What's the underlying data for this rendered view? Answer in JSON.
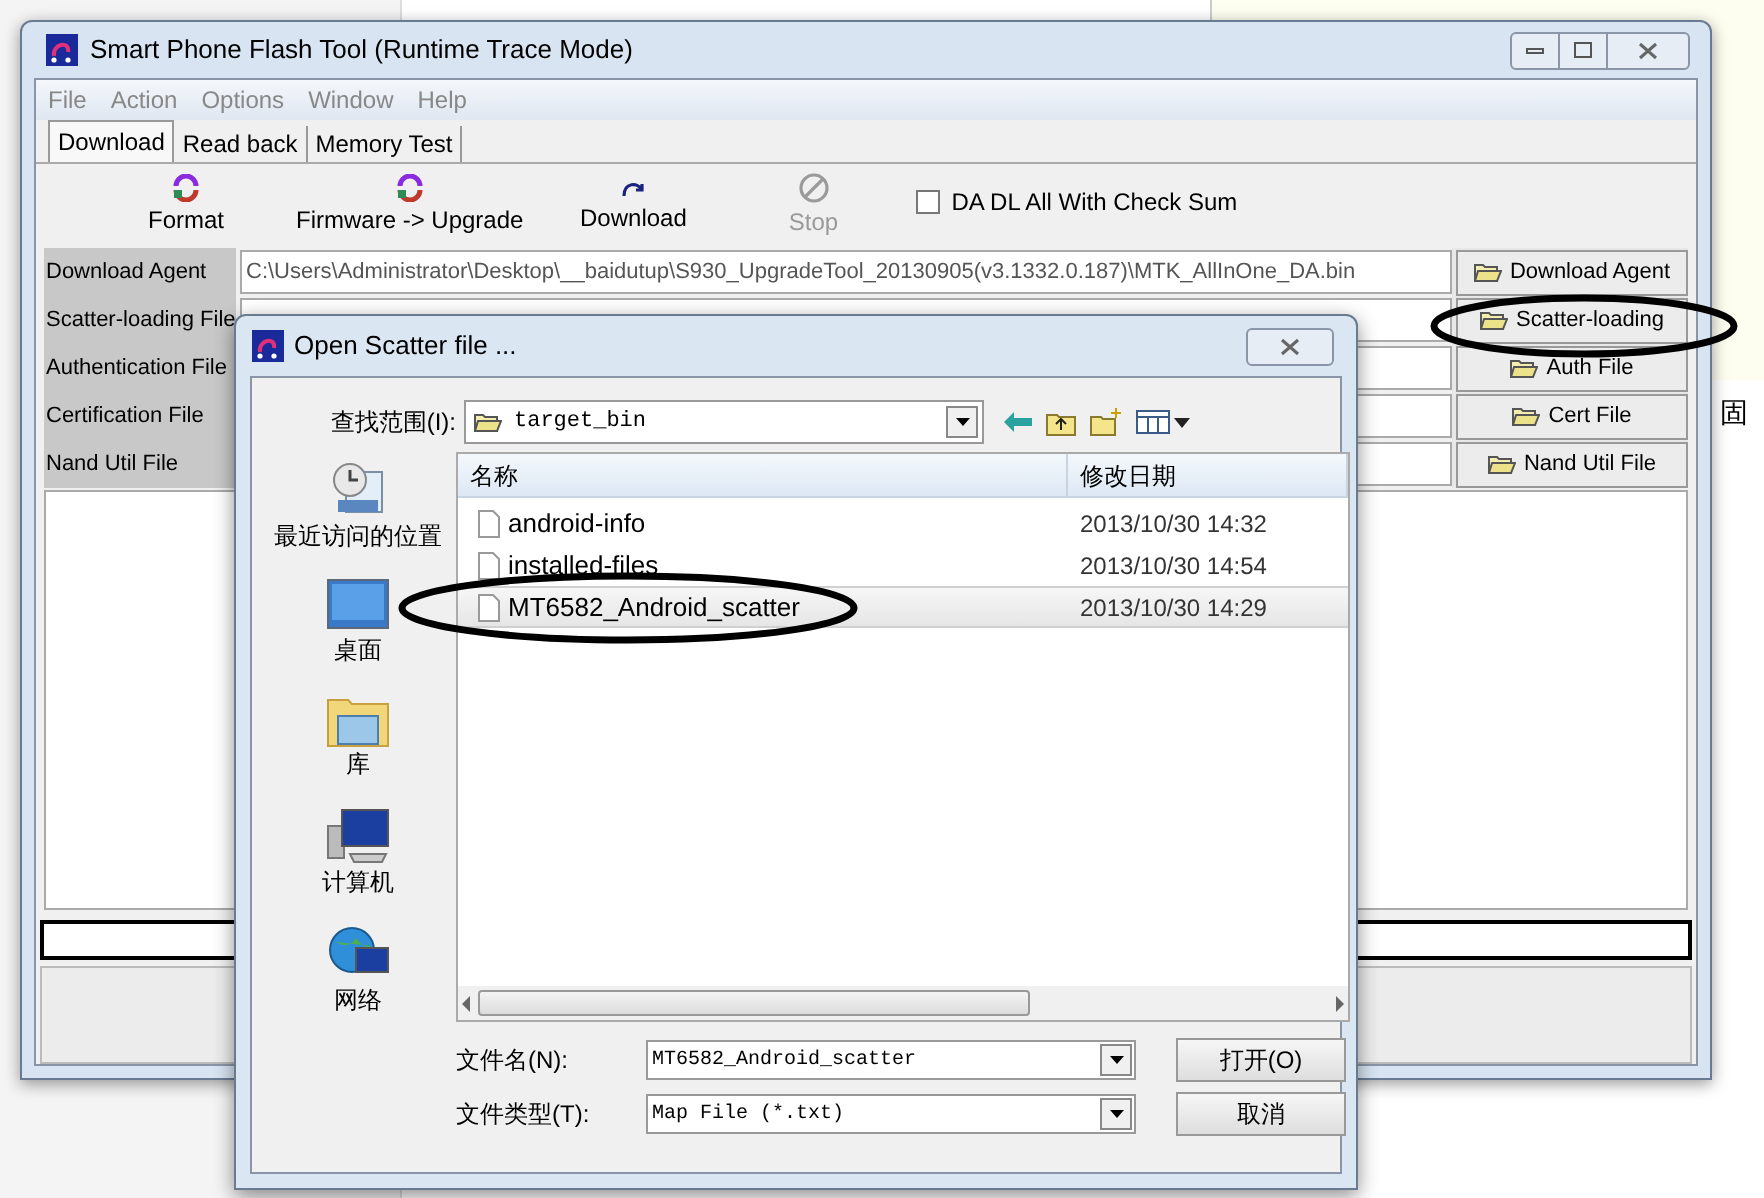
{
  "background_page": {
    "texts": [
      "固"
    ]
  },
  "main_window": {
    "title": "Smart Phone Flash Tool (Runtime Trace Mode)",
    "menu": [
      "File",
      "Action",
      "Options",
      "Window",
      "Help"
    ],
    "tabs": [
      {
        "label": "Download",
        "selected": true
      },
      {
        "label": "Read back",
        "selected": false
      },
      {
        "label": "Memory Test",
        "selected": false
      }
    ],
    "toolbar": [
      {
        "label": "Format",
        "kind": "format",
        "disabled": false
      },
      {
        "label": "Firmware -> Upgrade",
        "kind": "upgrade",
        "disabled": false
      },
      {
        "label": "Download",
        "kind": "download",
        "disabled": false
      },
      {
        "label": "Stop",
        "kind": "stop",
        "disabled": true
      }
    ],
    "checksum": {
      "label": "DA DL All With Check Sum",
      "checked": false
    },
    "file_rows": [
      {
        "label": "Download Agent",
        "value": "C:\\Users\\Administrator\\Desktop\\__baidutup\\S930_UpgradeTool_20130905(v3.1332.0.187)\\MTK_AllInOne_DA.bin",
        "button": "Download Agent"
      },
      {
        "label": "Scatter-loading File",
        "value": "",
        "button": "Scatter-loading"
      },
      {
        "label": "Authentication File",
        "value": "",
        "button": "Auth File"
      },
      {
        "label": "Certification File",
        "value": "",
        "button": "Cert File"
      },
      {
        "label": "Nand Util File",
        "value": "",
        "button": "Nand Util File"
      }
    ]
  },
  "dialog": {
    "title": "Open Scatter file ...",
    "look_in": {
      "label": "查找范围(I):",
      "value": "target_bin"
    },
    "places": [
      {
        "label": "最近访问的位置",
        "kind": "recent"
      },
      {
        "label": "桌面",
        "kind": "desktop"
      },
      {
        "label": "库",
        "kind": "library"
      },
      {
        "label": "计算机",
        "kind": "computer"
      },
      {
        "label": "网络",
        "kind": "network"
      }
    ],
    "columns": [
      "名称",
      "修改日期"
    ],
    "files": [
      {
        "name": "android-info",
        "date": "2013/10/30 14:32",
        "selected": false
      },
      {
        "name": "installed-files",
        "date": "2013/10/30 14:54",
        "selected": false
      },
      {
        "name": "MT6582_Android_scatter",
        "date": "2013/10/30 14:29",
        "selected": true
      }
    ],
    "file_name": {
      "label": "文件名(N):",
      "value": "MT6582_Android_scatter"
    },
    "file_type": {
      "label": "文件类型(T):",
      "value": "Map File (*.txt)"
    },
    "buttons": [
      "打开(O)",
      "取消"
    ]
  }
}
